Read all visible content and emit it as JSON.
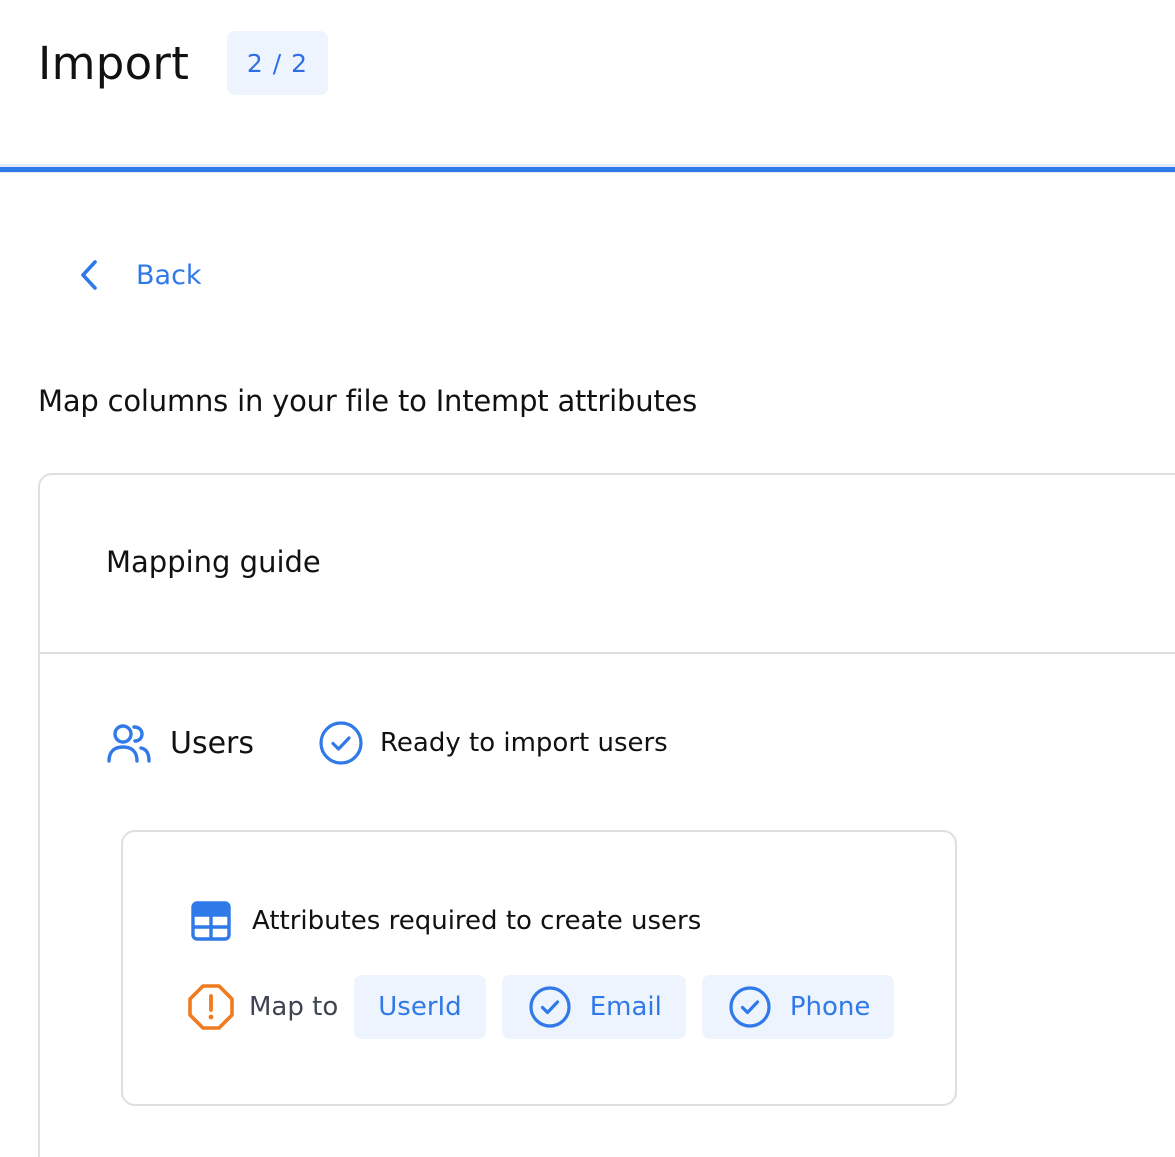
{
  "header": {
    "title": "Import",
    "step_badge": "2 / 2",
    "progress": 1.0
  },
  "nav": {
    "back_label": "Back",
    "back_icon": "chevron-left-icon"
  },
  "section": {
    "heading": "Map columns in your file to Intempt attributes"
  },
  "guide": {
    "title": "Mapping guide",
    "users": {
      "label": "Users",
      "icon": "users-icon",
      "status_icon": "check-circle-icon",
      "status_text": "Ready to import users"
    },
    "required": {
      "icon": "table-icon",
      "title": "Attributes required to create users",
      "warning_icon": "warning-octagon-icon",
      "map_to_label": "Map to",
      "attributes": [
        {
          "label": "UserId",
          "checked": false
        },
        {
          "label": "Email",
          "checked": true
        },
        {
          "label": "Phone",
          "checked": true
        }
      ]
    }
  },
  "colors": {
    "accent": "#2f79e8",
    "accent_bg": "#eef4fe",
    "warning": "#f07b1e",
    "border": "#dedfe3",
    "text": "#111111"
  }
}
